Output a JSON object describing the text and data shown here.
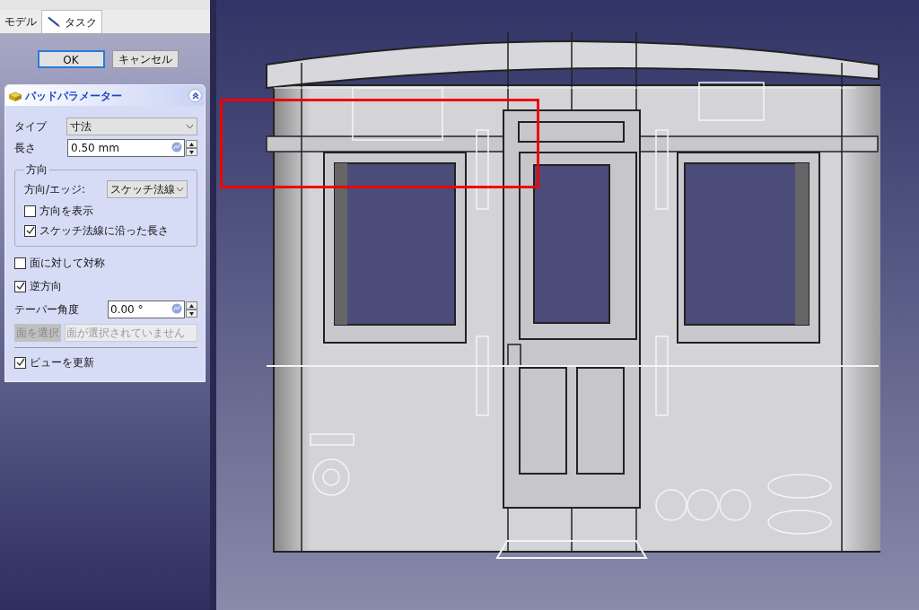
{
  "panel": {
    "tabs": [
      {
        "label": "モデル",
        "selected": false
      },
      {
        "label": "タスク",
        "selected": true
      }
    ],
    "buttons": [
      {
        "label": "OK",
        "default": true
      },
      {
        "label": "キャンセル",
        "default": false
      }
    ],
    "task": {
      "title": "パッドパラメーター",
      "expanded": true,
      "type": {
        "label": "タイプ",
        "value": "寸法"
      },
      "length": {
        "label": "長さ",
        "value": "0.50 mm"
      },
      "direction": {
        "title": "方向",
        "edge_label": "方向/エッジ:",
        "edge_value": "スケッチ法線",
        "checks": [
          {
            "label": "方向を表示",
            "checked": false
          },
          {
            "label": "スケッチ法線に沿った長さ",
            "checked": true
          }
        ]
      },
      "checks": [
        {
          "label": "面に対して対称",
          "checked": false
        },
        {
          "label": "逆方向",
          "checked": true
        }
      ],
      "taper": {
        "label": "テーパー角度",
        "value": "0.00 °"
      },
      "face": {
        "button": "面を選択",
        "disabled": true,
        "placeholder": "面が選択されていません"
      },
      "update": {
        "label": "ビューを更新",
        "checked": true
      }
    }
  }
}
